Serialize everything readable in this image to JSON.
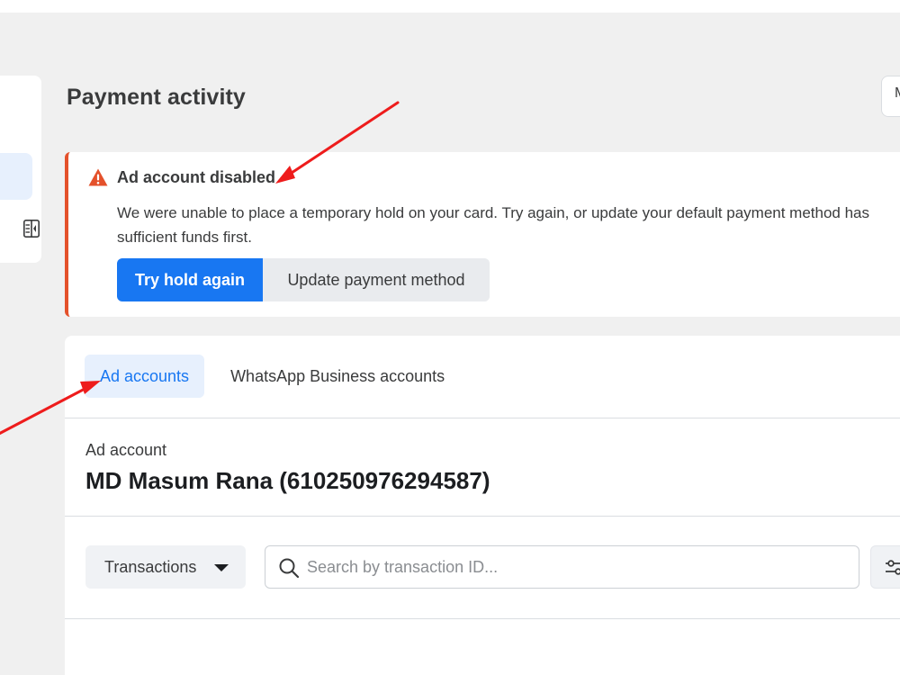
{
  "page": {
    "title": "Payment activity",
    "top_right_button_label": "M"
  },
  "alert": {
    "title": "Ad account disabled",
    "body": "We were unable to place a temporary hold on your card. Try again, or update your default payment method has sufficient funds first.",
    "primary_label": "Try hold again",
    "secondary_label": "Update payment method",
    "icon": "warning-triangle-icon",
    "accent_color": "#e4512b"
  },
  "tabs": [
    {
      "label": "Ad accounts",
      "active": true
    },
    {
      "label": "WhatsApp Business accounts",
      "active": false
    }
  ],
  "account": {
    "label": "Ad account",
    "name": "MD Masum Rana (610250976294587)"
  },
  "transactions": {
    "dropdown_label": "Transactions",
    "search_placeholder": "Search by transaction ID...",
    "search_value": ""
  },
  "colors": {
    "brand_blue": "#1877f2",
    "active_tab_bg": "#e7f0fd",
    "annotation_arrow": "#ee1c1c"
  }
}
